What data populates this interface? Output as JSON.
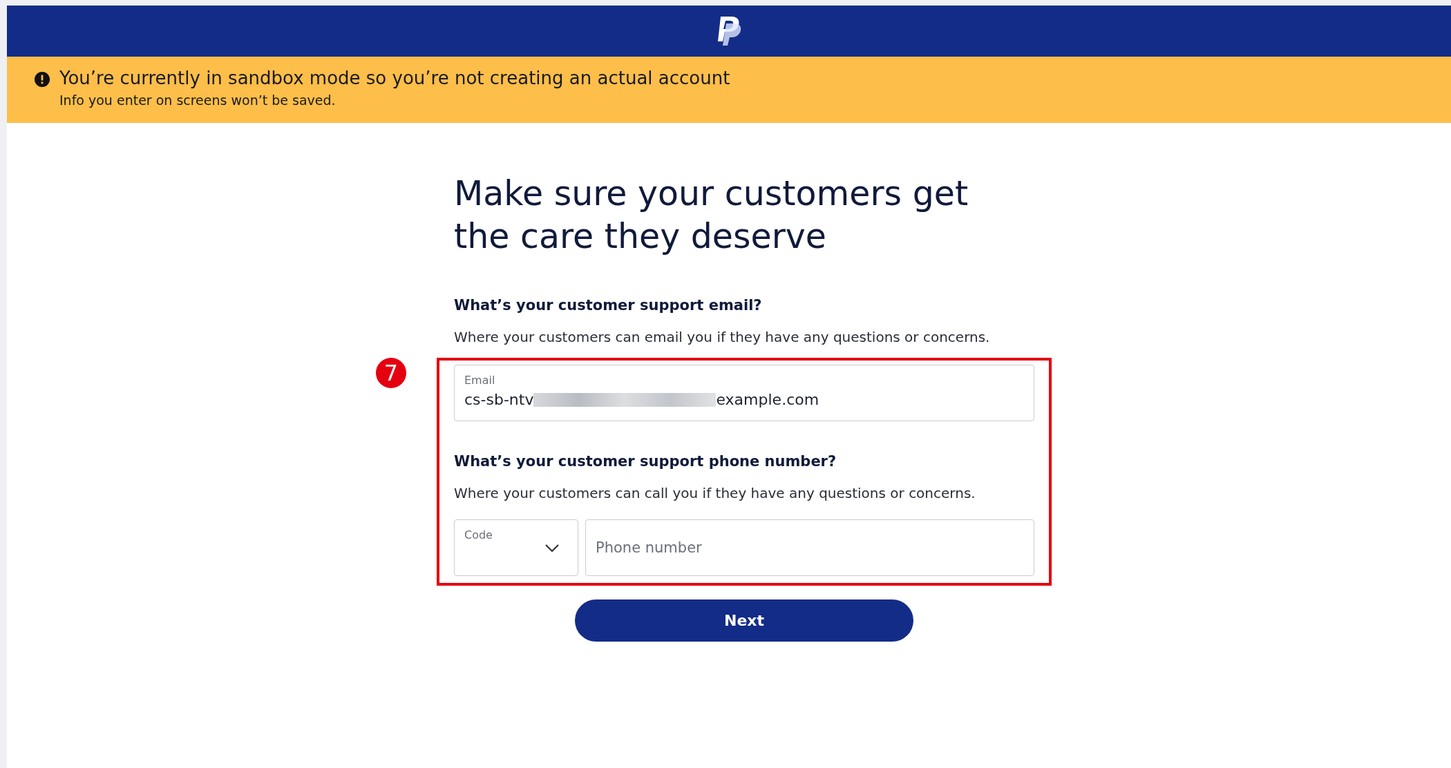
{
  "banner": {
    "title": "You’re currently in sandbox mode so you’re not creating an actual account",
    "subtitle": "Info you enter on screens won’t be saved."
  },
  "heading": "Make sure your customers get the care they deserve",
  "step_badge": "7",
  "email_section": {
    "question": "What’s your customer support email?",
    "description": "Where your customers can email you if they have any questions or concerns.",
    "field": {
      "label": "Email",
      "value_start": "cs-sb-ntv",
      "value_end": "example.com"
    }
  },
  "phone_section": {
    "question": "What’s your customer support phone number?",
    "description": "Where your customers can call you if they have any questions or concerns.",
    "code_field": {
      "label": "Code"
    },
    "phone_field": {
      "placeholder": "Phone number"
    }
  },
  "next_button": "Next"
}
